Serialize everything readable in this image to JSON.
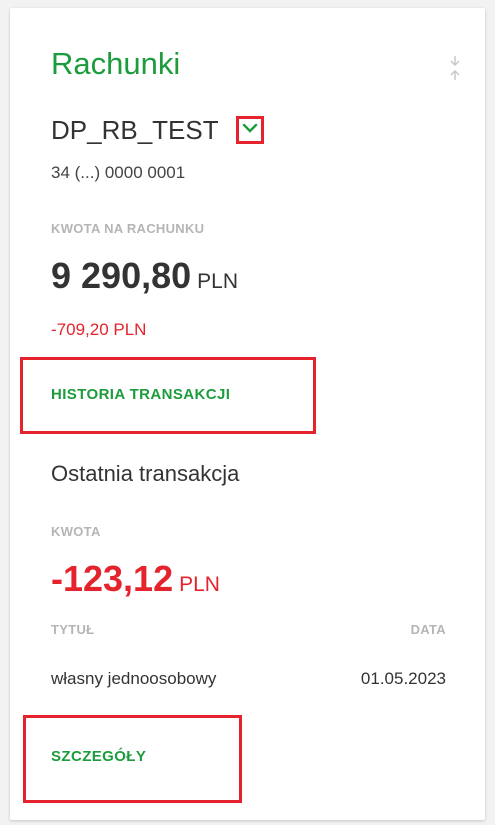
{
  "card": {
    "title": "Rachunki",
    "drag_icon": "drag-handle-icon"
  },
  "account": {
    "name": "DP_RB_TEST",
    "toggle_icon": "chevron-down-icon",
    "number": "34 (...) 0000 0001"
  },
  "balance": {
    "label": "KWOTA NA RACHUNKU",
    "amount": "9 290,80",
    "currency": "PLN",
    "difference": "-709,20 PLN"
  },
  "history_link": "HISTORIA TRANSAKCJI",
  "last_transaction": {
    "heading": "Ostatnia transakcja",
    "amount_label": "KWOTA",
    "amount": "-123,12",
    "currency": "PLN",
    "title_label": "TYTUŁ",
    "title_value": "własny jednoosobowy",
    "date_label": "DATA",
    "date_value": "01.05.2023"
  },
  "details_link": "SZCZEGÓŁY",
  "colors": {
    "accent_green": "#1c9c3c",
    "highlight_red": "#e4232d",
    "negative_red": "#e4232d"
  }
}
